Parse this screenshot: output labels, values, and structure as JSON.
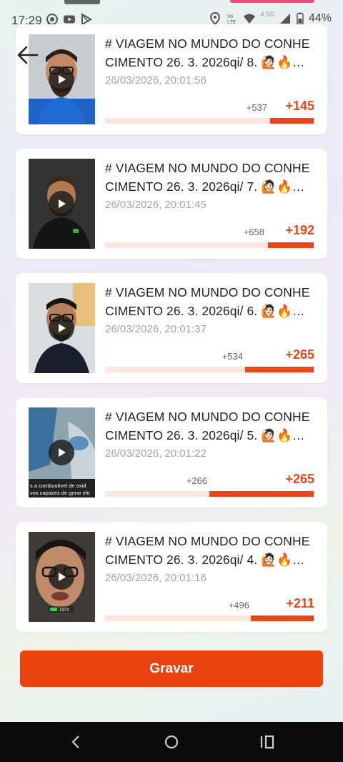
{
  "status": {
    "time": "17:29",
    "network": "4.5G",
    "battery": "44%",
    "icons": [
      "whatsapp-icon",
      "youtube-icon",
      "play-store-icon",
      "location-icon",
      "volte-icon",
      "wifi-icon",
      "signal-icon",
      "battery-icon"
    ]
  },
  "nav": {
    "back_icon": "arrow-left-icon"
  },
  "items": [
    {
      "title": "# VIAGEM NO MUNDO DO CONHECIMENTO 26. 3. 2026qi/ 8. 🙋🏻🔥...",
      "title_line1": "# VIAGEM NO MUNDO DO CONHE",
      "title_line2": "CIMENTO 26. 3. 2026qi/ 8. 🙋🏻🔥…",
      "date": "26/03/2026, 20:01:56",
      "small": "+537",
      "big": "+145",
      "progress": 0.21
    },
    {
      "title_line1": "# VIAGEM NO MUNDO DO CONHE",
      "title_line2": "CIMENTO 26. 3. 2026qi/ 7. 🙋🏻🔥…",
      "date": "26/03/2026, 20:01:45",
      "small": "+658",
      "big": "+192",
      "progress": 0.22
    },
    {
      "title_line1": "# VIAGEM NO MUNDO DO CONHE",
      "title_line2": "CIMENTO 26. 3. 2026qi/ 6. 🙋🏻🔥…",
      "date": "26/03/2026, 20:01:37",
      "small": "+534",
      "big": "+265",
      "progress": 0.33
    },
    {
      "title_line1": "# VIAGEM NO MUNDO DO CONHE",
      "title_line2": "CIMENTO 26. 3. 2026qi/ 5. 🙋🏻🔥…",
      "date": "26/03/2026, 20:01:22",
      "small": "+266",
      "big": "+265",
      "progress": 0.5
    },
    {
      "title_line1": "# VIAGEM NO MUNDO DO CONHE",
      "title_line2": "CIMENTO 26. 3. 2026qi/ 4. 🙋🏻🔥…",
      "date": "26/03/2026, 20:01:16",
      "small": "+496",
      "big": "+211",
      "progress": 0.3
    }
  ],
  "thumb_captions": {
    "item4_line1": "s a combustível de oxid",
    "item4_line2": "vos capazes de gerar ele",
    "item5_badge": "1973"
  },
  "record_button": "Gravar",
  "colors": {
    "accent": "#e9420f",
    "track": "#fde4dc",
    "date": "#a3a3a3"
  }
}
